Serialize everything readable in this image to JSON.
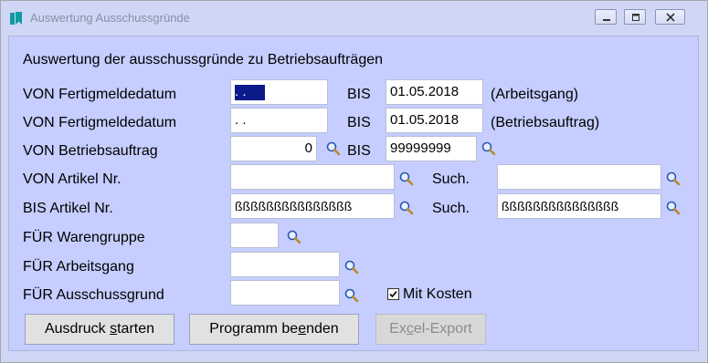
{
  "window": {
    "title": "Auswertung Ausschussgründe",
    "controls": {
      "minimize": "minimize-icon",
      "maximize": "maximize-icon",
      "close": "close-icon"
    }
  },
  "form": {
    "heading": "Auswertung der ausschussgründe zu Betriebsaufträgen",
    "row1": {
      "label": "VON Fertigmeldedatum",
      "from_value": " .  .",
      "bis_label": "BIS",
      "to_value": "01.05.2018",
      "note": "(Arbeitsgang)"
    },
    "row2": {
      "label": "VON Fertigmeldedatum",
      "from_value": " .  .",
      "bis_label": "BIS",
      "to_value": "01.05.2018",
      "note": "(Betriebsauftrag)"
    },
    "row3": {
      "label": "VON Betriebsauftrag",
      "from_value": "0",
      "bis_label": "BIS",
      "to_value": "99999999"
    },
    "row4": {
      "label": "VON Artikel Nr.",
      "value": "",
      "such_label": "Such.",
      "such_value": ""
    },
    "row5": {
      "label": "BIS Artikel Nr.",
      "value": "ßßßßßßßßßßßßßßß",
      "such_label": "Such.",
      "such_value": "ßßßßßßßßßßßßßßß"
    },
    "row6": {
      "label": "FÜR Warengruppe",
      "value": ""
    },
    "row7": {
      "label": "FÜR Arbeitsgang",
      "value": ""
    },
    "row8": {
      "label": "FÜR Ausschussgrund",
      "value": ""
    },
    "checkbox": {
      "label": "Mit Kosten",
      "checked": true
    }
  },
  "buttons": {
    "print": {
      "pre": "Ausdruck ",
      "underlined": "s",
      "post": "tarten"
    },
    "quit": {
      "pre": "Programm be",
      "underlined": "e",
      "post": "nden"
    },
    "excel": {
      "pre": "Ex",
      "underlined": "c",
      "post": "el-Export"
    }
  },
  "colors": {
    "background": "#c5ceff",
    "selection": "#0a1a8a",
    "accent_icon": "#0f9aa0"
  }
}
